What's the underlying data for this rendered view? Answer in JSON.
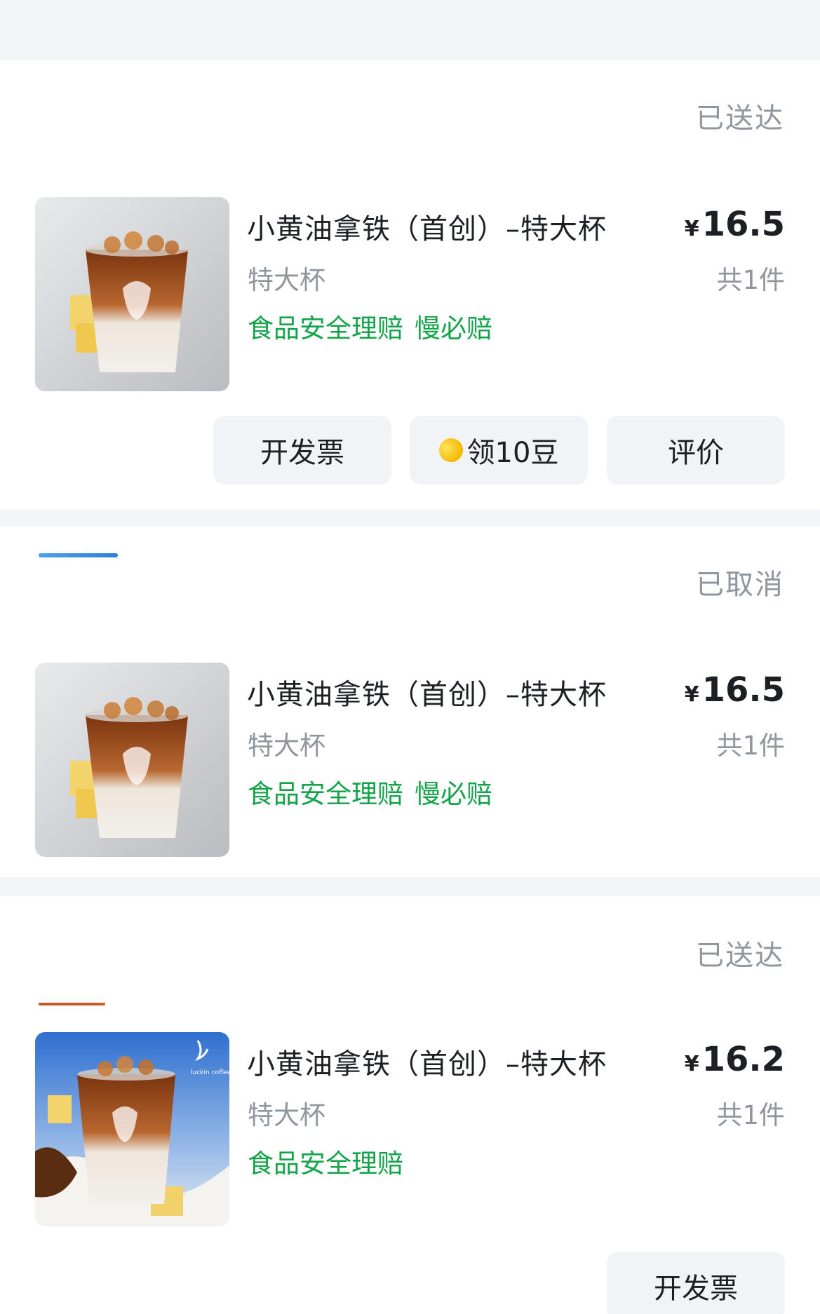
{
  "orders": [
    {
      "status": "已送达",
      "product_name": "小黄油拿铁（首创）–特大杯",
      "spec": "特大杯",
      "promo_tags": [
        "食品安全理赔",
        "慢必赔"
      ],
      "currency": "¥",
      "price": "16.5",
      "quantity": "共1件",
      "actions": {
        "invoice": "开发票",
        "beans": "领10豆",
        "review": "评价"
      }
    },
    {
      "status": "已取消",
      "product_name": "小黄油拿铁（首创）–特大杯",
      "spec": "特大杯",
      "promo_tags": [
        "食品安全理赔",
        "慢必赔"
      ],
      "currency": "¥",
      "price": "16.5",
      "quantity": "共1件"
    },
    {
      "status": "已送达",
      "product_name": "小黄油拿铁（首创）–特大杯",
      "spec": "特大杯",
      "promo_tags": [
        "食品安全理赔"
      ],
      "currency": "¥",
      "price": "16.2",
      "quantity": "共1件",
      "actions": {
        "invoice": "开发票"
      }
    }
  ],
  "icons": {
    "bean": "coffee-bean-icon"
  },
  "colors": {
    "page_bg": "#f3f5f8",
    "card_bg": "#ffffff",
    "status_gray": "#8f969e",
    "promo_green": "#13a349",
    "button_bg": "#f1f3f6",
    "bean_yellow": "#f5b800"
  }
}
